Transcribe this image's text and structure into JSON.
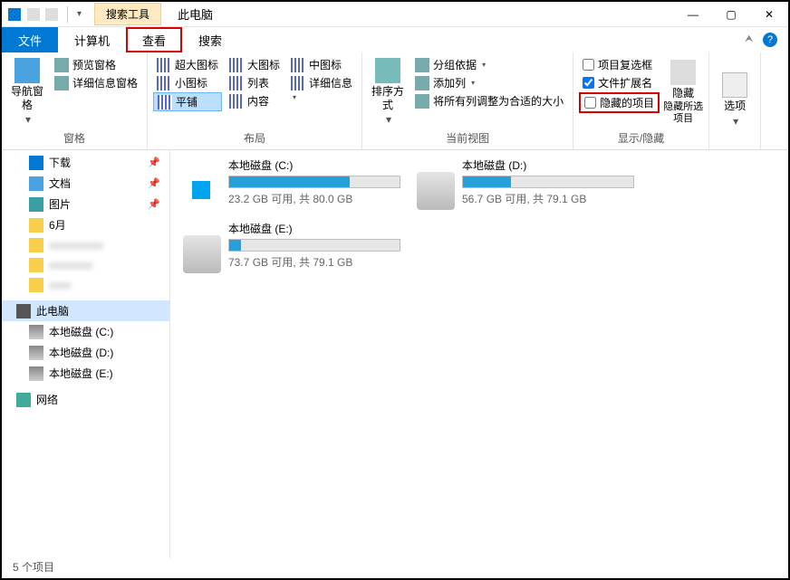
{
  "titlebar": {
    "contextual_tab": "搜索工具",
    "title": "此电脑"
  },
  "win_controls": {
    "min": "—",
    "max": "▢",
    "close": "✕"
  },
  "tabs": {
    "file": "文件",
    "computer": "计算机",
    "view": "查看",
    "search": "搜索"
  },
  "ribbon": {
    "panes": {
      "nav": "导航窗格",
      "preview": "预览窗格",
      "details_pane": "详细信息窗格",
      "panes_label": "窗格"
    },
    "layout": {
      "xl_icons": "超大图标",
      "l_icons": "大图标",
      "m_icons": "中图标",
      "s_icons": "小图标",
      "list": "列表",
      "details": "详细信息",
      "tiles": "平铺",
      "content": "内容",
      "label": "布局"
    },
    "current_view": {
      "sort": "排序方式",
      "group_by": "分组依据",
      "add_column": "添加列",
      "fit_columns": "将所有列调整为合适的大小",
      "label": "当前视图"
    },
    "show_hide": {
      "item_checkboxes": "项目复选框",
      "file_ext": "文件扩展名",
      "hidden_items": "隐藏的项目",
      "hide_selected": "隐藏所选项目",
      "hide_btn": "隐藏",
      "label": "显示/隐藏"
    },
    "options": "选项"
  },
  "tree": {
    "downloads": "下载",
    "documents": "文档",
    "pictures": "图片",
    "month6": "6月",
    "this_pc": "此电脑",
    "disk_c": "本地磁盘 (C:)",
    "disk_d": "本地磁盘 (D:)",
    "disk_e": "本地磁盘 (E:)",
    "network": "网络"
  },
  "drives": [
    {
      "name": "本地磁盘 (C:)",
      "text": "23.2 GB 可用, 共 80.0 GB",
      "fill": 71,
      "icon": "c"
    },
    {
      "name": "本地磁盘 (D:)",
      "text": "56.7 GB 可用, 共 79.1 GB",
      "fill": 28,
      "icon": "d"
    },
    {
      "name": "本地磁盘 (E:)",
      "text": "73.7 GB 可用, 共 79.1 GB",
      "fill": 7,
      "icon": "e"
    }
  ],
  "statusbar": {
    "count": "5 个项目"
  }
}
